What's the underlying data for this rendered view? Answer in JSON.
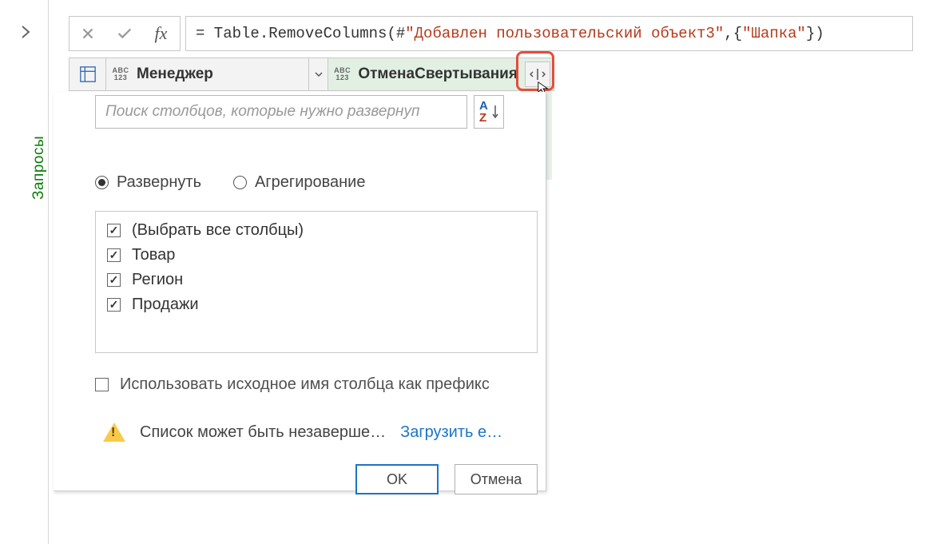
{
  "sidebar": {
    "queries_label": "Запросы"
  },
  "formula": {
    "prefix": "= Table.RemoveColumns(#",
    "arg1": "\"Добавлен пользовательский объект3\"",
    "mid": ",{",
    "arg2": "\"Шапка\"",
    "suffix": "})"
  },
  "columns": [
    {
      "name": "Менеджер",
      "type": "Any"
    },
    {
      "name": "ОтменаСвертывания",
      "type": "Table"
    }
  ],
  "expand_popup": {
    "search_placeholder": "Поиск столбцов, которые нужно развернуп",
    "mode_expand": "Развернуть",
    "mode_aggregate": "Агрегирование",
    "selected_mode": "expand",
    "select_all": "(Выбрать все столбцы)",
    "items": [
      "Товар",
      "Регион",
      "Продажи"
    ],
    "items_checked": [
      true,
      true,
      true
    ],
    "all_checked": true,
    "prefix_label": "Использовать исходное имя столбца как префикс",
    "prefix_checked": false,
    "warning": "Список может быть незаверше…",
    "load_more": "Загрузить е…",
    "ok": "OK",
    "cancel": "Отмена"
  }
}
